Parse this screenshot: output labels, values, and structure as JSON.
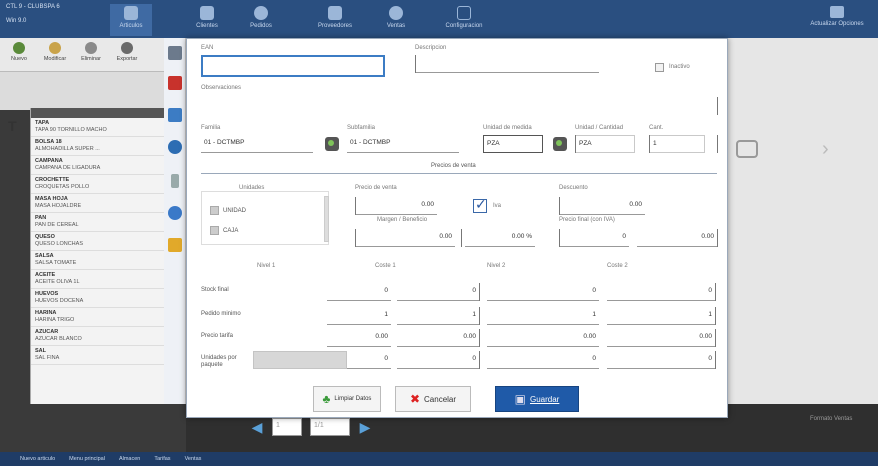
{
  "app": {
    "title_line1": "CTL 9 - CLUBSPA 6",
    "title_line2": "Win 9.0 ",
    "tab_active": "Articulos"
  },
  "ribbon": {
    "tabs": [
      "Articulos",
      "Clientes",
      "Pedidos",
      "Proveedores",
      "Ventas",
      "Configuracion"
    ],
    "right_label": "Actualizar Opciones"
  },
  "subbar": {
    "buttons": [
      "Nuevo",
      "Modificar",
      "Eliminar",
      "Exportar"
    ]
  },
  "side_list": {
    "items": [
      {
        "t": "TAPA",
        "s": "TAPA 90 TORNILLO MACHO"
      },
      {
        "t": "BOLSA 18",
        "s": "ALMOHADILLA SUPER ..."
      },
      {
        "t": "CAMPANA",
        "s": "CAMPANA DE LIGADURA"
      },
      {
        "t": "CROCHETTE",
        "s": "CROQUETAS POLLO"
      },
      {
        "t": "MASA HOJA",
        "s": "MASA HOJALDRE"
      },
      {
        "t": "PAN",
        "s": "PAN DE CEREAL"
      },
      {
        "t": "QUESO",
        "s": "QUESO LONCHAS"
      },
      {
        "t": "SALSA",
        "s": "SALSA TOMATE"
      },
      {
        "t": "ACEITE",
        "s": "ACEITE OLIVA 1L"
      },
      {
        "t": "HUEVOS",
        "s": "HUEVOS DOCENA"
      },
      {
        "t": "HARINA",
        "s": "HARINA TRIGO"
      },
      {
        "t": "AZUCAR",
        "s": "AZUCAR BLANCO"
      },
      {
        "t": "SAL",
        "s": "SAL FINA"
      }
    ]
  },
  "modal": {
    "codigo_label": "EAN",
    "codigo_value": "",
    "descripcion_label": "Descripcion",
    "descripcion_value": "",
    "inactivo_label": "Inactivo",
    "observaciones_label": "Observaciones",
    "familia_label": "Familia",
    "familia_value": "01 - DCTMBP",
    "subfamilia_label": "Subfamilia",
    "subfamilia_value": "01 - DCTMBP",
    "unidad_label": "Unidad de medida",
    "unidad_value": "PZA",
    "unidad_extra_label": "Unidad / Cantidad",
    "unidad_extra_value": "PZA",
    "unidad_extra_num_label": "Cant.",
    "unidad_extra_num_value": "1",
    "precios_title": "Precios de venta",
    "units_header": "Unidades",
    "units": [
      "UNIDAD",
      "CAJA"
    ],
    "precio_label": "Precio de venta",
    "precio_value": "0.00",
    "iva_label": "Iva",
    "descuento_label": "Descuento",
    "descuento_value": "0.00",
    "margen_label": "Margen / Beneficio",
    "margen_pct": "0.00 %",
    "precio_final_label": "Precio final",
    "precio_final_value": "0.00",
    "precio_final_iva_label": "Precio final (con IVA)",
    "precio_final_iva_value": "0",
    "precio_final_iva_pct": "0.00",
    "table_headers": [
      "Nivel 1",
      "Coste 1",
      "Nivel 2",
      "Coste 2"
    ],
    "rows": [
      {
        "label": "Stock final",
        "v": [
          "0",
          "0",
          "0",
          "0"
        ]
      },
      {
        "label": "Pedido minimo",
        "v": [
          "1",
          "1",
          "1",
          "1"
        ]
      },
      {
        "label": "Precio tarifa",
        "v": [
          "0.00",
          "0.00",
          "0.00",
          "0.00"
        ]
      },
      {
        "label": "Unidades por paquete",
        "v": [
          "0",
          "0",
          "0",
          "0"
        ]
      }
    ]
  },
  "buttons": {
    "clear": "Limpiar Datos",
    "cancel": "Cancelar",
    "save": "Guardar"
  },
  "bottom": {
    "page": "1",
    "total": "1/1",
    "right": "Formato Ventas"
  },
  "status": [
    "Nuevo articulo",
    "Menu principal",
    "Almacen",
    "Tarifas",
    "Ventas"
  ]
}
